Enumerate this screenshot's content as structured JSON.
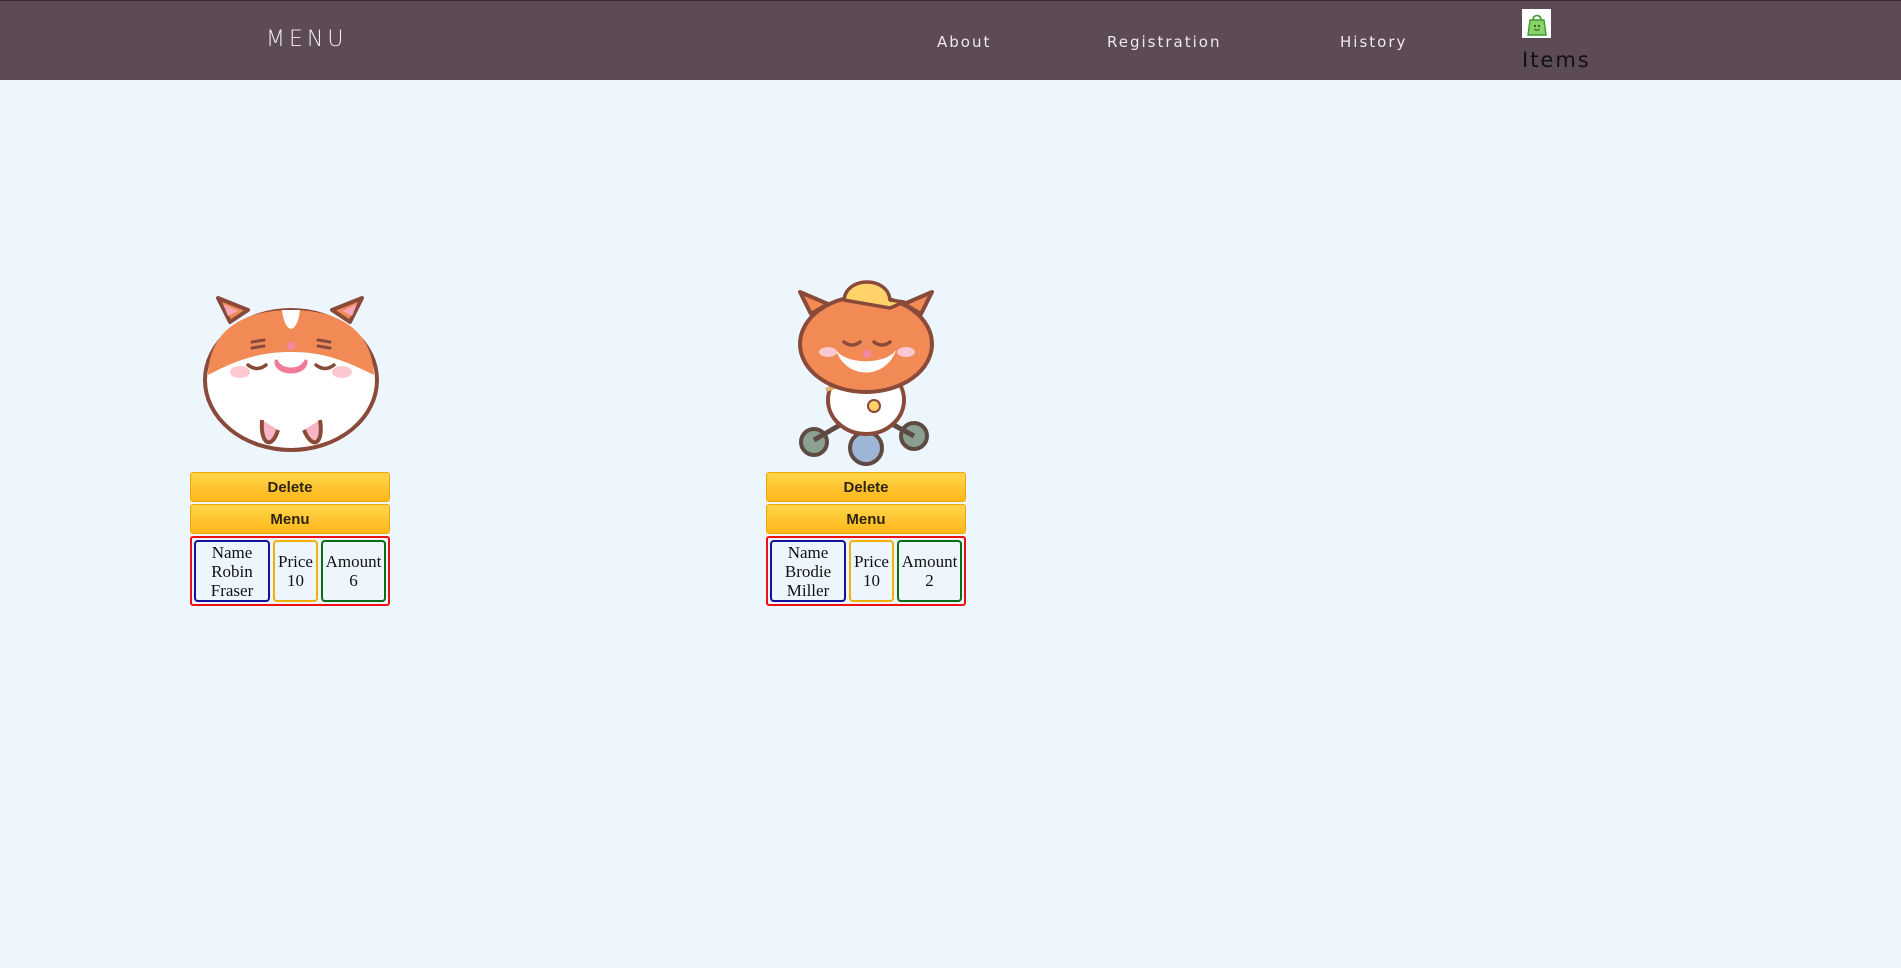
{
  "nav": {
    "brand": "MENU",
    "links": [
      "About",
      "Registration",
      "History"
    ],
    "cart_label": "Items",
    "cart_icon": "shopping-bag-icon"
  },
  "cards": [
    {
      "image": "hamster-sleeping-illustration",
      "delete_label": "Delete",
      "menu_label": "Menu",
      "name_header": "Name",
      "name_lines": [
        "Robin",
        "Fraser"
      ],
      "price_header": "Price",
      "price": "10",
      "amount_header": "Amount",
      "amount": "6"
    },
    {
      "image": "hamster-on-tricycle-illustration",
      "delete_label": "Delete",
      "menu_label": "Menu",
      "name_header": "Name",
      "name_lines": [
        "Brodie",
        "Miller"
      ],
      "price_header": "Price",
      "price": "10",
      "amount_header": "Amount",
      "amount": "2"
    }
  ],
  "colors": {
    "navbar": "#5c4a57",
    "background": "#eef6fd",
    "button": "#ffc52e",
    "info_border": "#e11111",
    "name_border": "#11119b",
    "price_border": "#f0b100",
    "amount_border": "#0d6b15"
  }
}
